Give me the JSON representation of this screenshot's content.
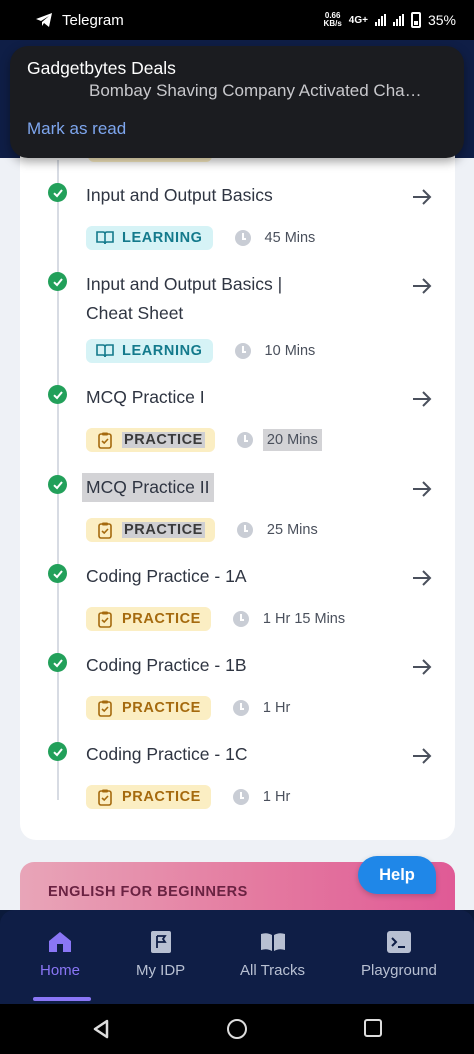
{
  "status_bar": {
    "app_name": "Telegram",
    "speed_value": "0.66",
    "speed_unit": "KB/s",
    "network": "4G+",
    "battery": "35%"
  },
  "notification": {
    "title": "Gadgetbytes Deals",
    "body": "Bombay Shaving Company Activated Cha…",
    "action": "Mark as read"
  },
  "course_items": [
    {
      "title": "Input and Output Basics",
      "type": "LEARNING",
      "duration": "45 Mins"
    },
    {
      "title_line1": "Input and Output Basics |",
      "title_line2": "Cheat Sheet",
      "type": "LEARNING",
      "duration": "10 Mins"
    },
    {
      "title": "MCQ Practice I",
      "type": "PRACTICE",
      "duration": "20 Mins"
    },
    {
      "title": "MCQ Practice II",
      "type": "PRACTICE",
      "duration": "25 Mins"
    },
    {
      "title": "Coding Practice - 1A",
      "type": "PRACTICE",
      "duration": "1 Hr 15 Mins"
    },
    {
      "title": "Coding Practice - 1B",
      "type": "PRACTICE",
      "duration": "1 Hr"
    },
    {
      "title": "Coding Practice - 1C",
      "type": "PRACTICE",
      "duration": "1 Hr"
    }
  ],
  "english_banner": {
    "label": "ENGLISH FOR BEGINNERS"
  },
  "help_button": {
    "label": "Help"
  },
  "bottom_nav": {
    "items": [
      {
        "label": "Home",
        "icon": "home-icon",
        "active": true
      },
      {
        "label": "My IDP",
        "icon": "flag-icon",
        "active": false
      },
      {
        "label": "All Tracks",
        "icon": "book-icon",
        "active": false
      },
      {
        "label": "Playground",
        "icon": "terminal-icon",
        "active": false
      }
    ]
  },
  "colors": {
    "accent": "#8a76f6",
    "check_green": "#22a05a",
    "learning_bg": "#d6f3f6",
    "practice_bg": "#fbeec3",
    "help_blue": "#1f87e8"
  }
}
